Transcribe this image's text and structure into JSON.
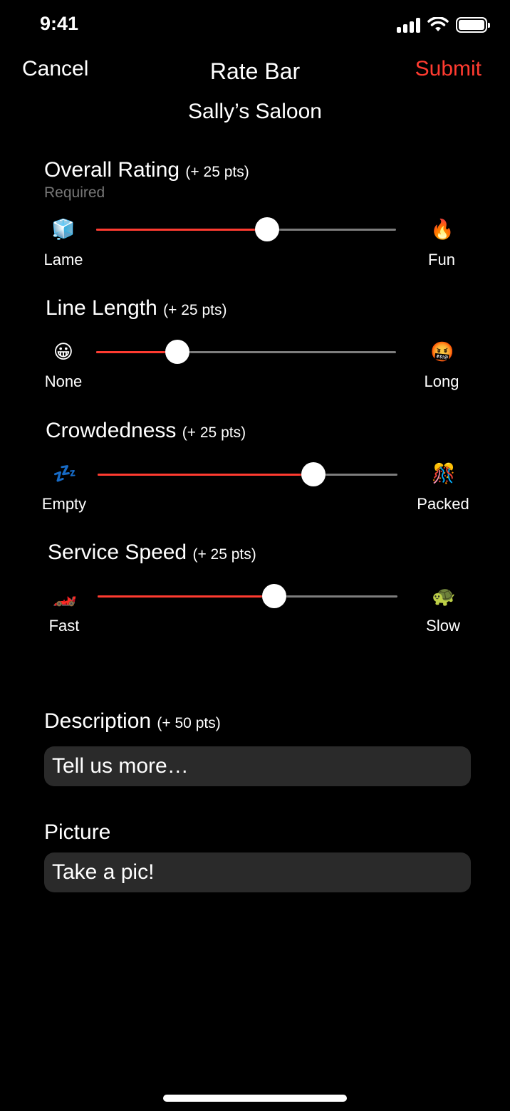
{
  "status": {
    "time": "9:41"
  },
  "nav": {
    "cancel": "Cancel",
    "title": "Rate Bar",
    "submit": "Submit",
    "submit_color": "#ff3b30"
  },
  "venue": "Sally’s Saloon",
  "accent_color": "#ff3b30",
  "ratings": [
    {
      "title": "Overall Rating",
      "points": "(+ 25 pts)",
      "required": "Required",
      "left_emoji": "🧊",
      "left_icon": "ice-cube-icon",
      "left_label": "Lame",
      "right_emoji": "🔥",
      "right_icon": "fire-icon",
      "right_label": "Fun",
      "value": 0.57
    },
    {
      "title": "Line Length",
      "points": "(+ 25 pts)",
      "left_emoji": "😀",
      "left_icon": "grinning-face-icon",
      "left_label": "None",
      "right_emoji": "🤬",
      "right_icon": "cursing-face-icon",
      "right_label": "Long",
      "value": 0.27
    },
    {
      "title": "Crowdedness",
      "points": "(+ 25 pts)",
      "left_emoji": "💤",
      "left_icon": "zzz-icon",
      "left_label": "Empty",
      "right_emoji": "🎊",
      "right_icon": "confetti-ball-icon",
      "right_label": "Packed",
      "value": 0.72
    },
    {
      "title": "Service Speed",
      "points": "(+ 25 pts)",
      "left_emoji": "🏎️",
      "left_icon": "race-car-icon",
      "left_label": "Fast",
      "right_emoji": "🐢",
      "right_icon": "turtle-icon",
      "right_label": "Slow",
      "value": 0.59
    }
  ],
  "description": {
    "label": "Description",
    "points": "(+ 50 pts)",
    "placeholder": "Tell us more…"
  },
  "picture": {
    "label": "Picture",
    "placeholder": "Take a pic!"
  }
}
